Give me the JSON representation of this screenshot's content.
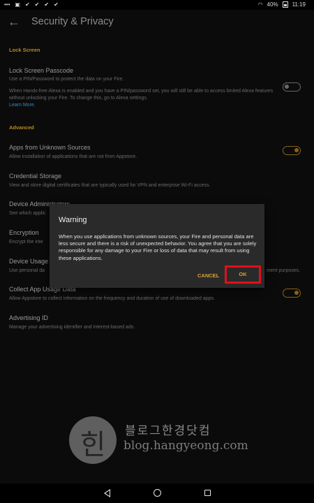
{
  "status_bar": {
    "battery": "40%",
    "time": "11:19"
  },
  "header": {
    "title": "Security & Privacy"
  },
  "sections": {
    "lock_screen": "Lock Screen",
    "advanced": "Advanced"
  },
  "settings": {
    "lock_passcode": {
      "title": "Lock Screen Passcode",
      "desc1": "Use a PIN/Password to protect the data on your Fire.",
      "desc2": "When Hands-free Alexa is enabled and you have a PIN/password set, you will still be able to access limited Alexa features without unlocking your Fire. To change this, go to Alexa settings.",
      "link": "Learn More."
    },
    "unknown_sources": {
      "title": "Apps from Unknown Sources",
      "desc": "Allow installation of applications that are not from Appstore."
    },
    "credential_storage": {
      "title": "Credential Storage",
      "desc": "View and store digital certificates that are typically used for VPN and enterprise Wi-Fi access."
    },
    "device_admin": {
      "title": "Device Administrators",
      "desc": "See which applic"
    },
    "encryption": {
      "title": "Encryption",
      "desc": "Encrypt the inte"
    },
    "device_usage": {
      "title": "Device Usage",
      "desc": "Use personal da",
      "desc_tail": "ment purposes."
    },
    "collect_usage": {
      "title": "Collect App Usage Data",
      "desc": "Allow Appstore to collect information on the frequency and duration of use of downloaded apps."
    },
    "advertising": {
      "title": "Advertising ID",
      "desc": "Manage your advertising identifier and interest-based ads."
    }
  },
  "dialog": {
    "title": "Warning",
    "message": "When you use applications from unknown sources, your Fire and personal data are less secure and there is a risk of unexpected behavior. You agree that you are solely responsible for any damage to your Fire or loss of data that may result from using these applications.",
    "cancel": "CANCEL",
    "ok": "OK"
  },
  "watermark": {
    "seal_char": "힌",
    "korean": "블로그한경닷컴",
    "url": "blog.hangyeong.com"
  },
  "colors": {
    "accent": "#d9a23a",
    "highlight": "#e0101a",
    "link": "#2a8dd4"
  }
}
